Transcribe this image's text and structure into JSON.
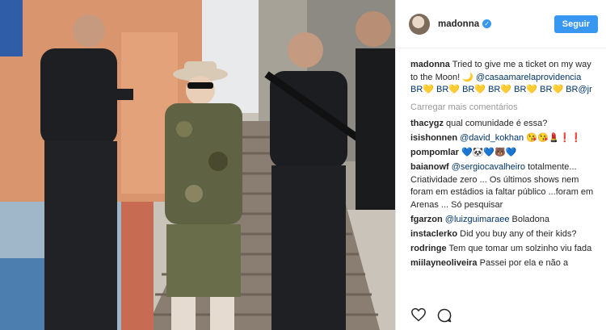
{
  "post": {
    "username": "madonna",
    "follow_label": "Seguir",
    "caption_text": "Tried to give me a ticket on my way to the Moon! 🌙",
    "caption_mentions": "@casaamarelaprovidencia BR💛 BR💛 BR💛 BR💛 BR💛 BR💛 BR@jr",
    "load_more": "Carregar mais comentários"
  },
  "comments": [
    {
      "user": "thacygz",
      "text": "qual comunidade é essa?"
    },
    {
      "user": "isishonnen",
      "mention": "@david_kokhan",
      "text": "😘😘💄❗❗"
    },
    {
      "user": "pompomlar",
      "text": "💙🐼💙🐻💙"
    },
    {
      "user": "baianowf",
      "mention": "@sergiocavalheiro",
      "text": "totalmente... Criatividade zero ... Os últimos shows nem foram em estádios ia faltar público ...foram em Arenas ... Só pesquisar"
    },
    {
      "user": "fgarzon",
      "mention": "@luizguimaraee",
      "text": "Boladona"
    },
    {
      "user": "instaclerko",
      "text": "Did you buy any of their kids?"
    },
    {
      "user": "rodringe",
      "text": "Tem que tomar um solzinho viu fada"
    },
    {
      "user": "miilayneoliveira",
      "text": "Passei por ela e não a"
    }
  ],
  "icons": {
    "like": "heart-icon",
    "comment": "comment-icon",
    "verified": "verified-badge-icon"
  },
  "colors": {
    "follow": "#3897f0",
    "link": "#003569",
    "muted": "#999999"
  }
}
